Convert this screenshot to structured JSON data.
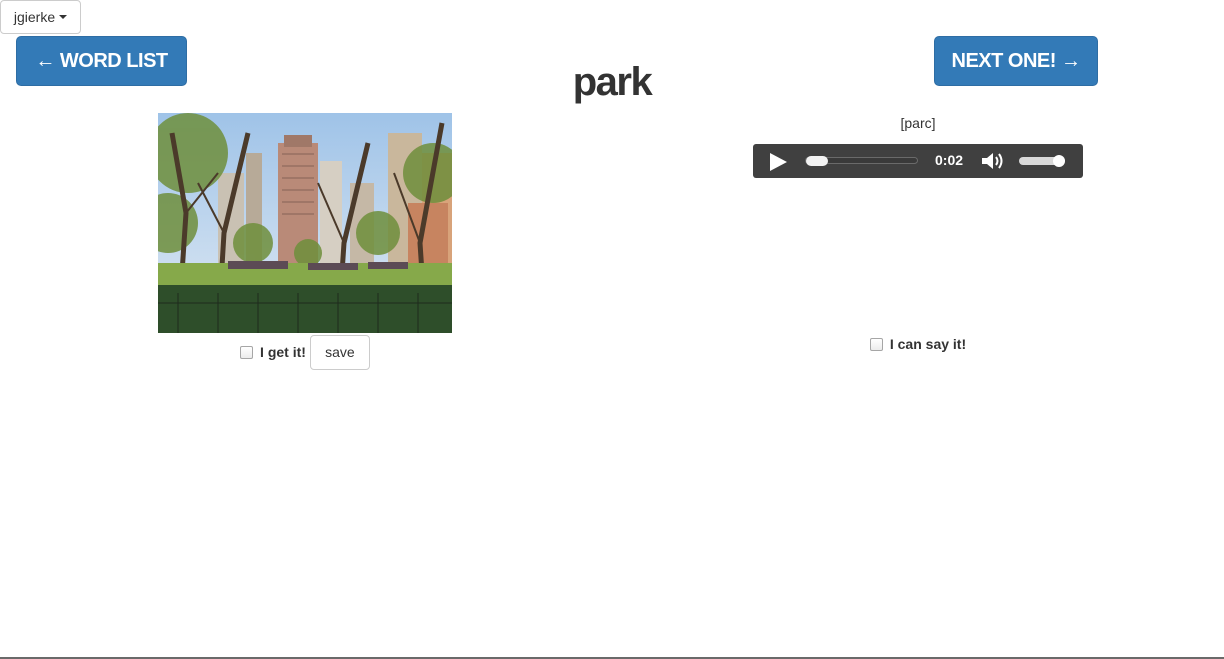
{
  "user_menu": {
    "username": "jgierke"
  },
  "nav": {
    "word_list_label": "← WORD LIST",
    "next_label": "NEXT ONE! →"
  },
  "word": "park",
  "comprehension": {
    "checkbox_label": "I get it!",
    "save_label": "save"
  },
  "pronunciation": {
    "phonetic": "[parc]",
    "audio_time": "0:02",
    "checkbox_label": "I can say it!"
  },
  "colors": {
    "primary_button": "#337ab7",
    "audio_bar": "#404040"
  }
}
